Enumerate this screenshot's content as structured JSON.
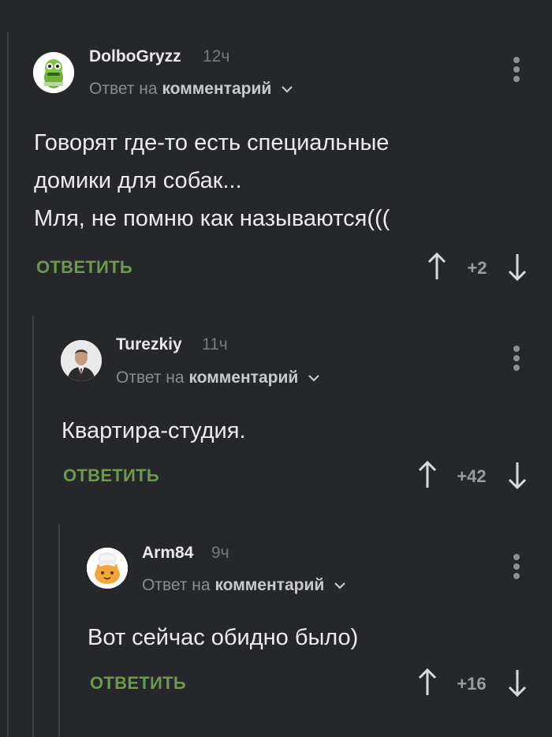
{
  "comments": [
    {
      "username": "DolboGryzz",
      "time": "12ч",
      "reply_prefix": "Ответ на",
      "reply_target": "комментарий",
      "text": "Говорят где-то есть специальные\nдомики для собак...\nМля, не помню как называются(((",
      "reply_label": "ОТВЕТИТЬ",
      "score": "+2",
      "avatar_icon": "green-character-avatar"
    },
    {
      "username": "Turezkiy",
      "time": "11ч",
      "reply_prefix": "Ответ на",
      "reply_target": "комментарий",
      "text": "Квартира-студия.",
      "reply_label": "ОТВЕТИТЬ",
      "score": "+42",
      "avatar_icon": "man-in-suit-avatar"
    },
    {
      "username": "Arm84",
      "time": "9ч",
      "reply_prefix": "Ответ на",
      "reply_target": "комментарий",
      "text": "Вот сейчас обидно было)",
      "reply_label": "ОТВЕТИТЬ",
      "score": "+16",
      "avatar_icon": "orange-cat-chef-avatar"
    }
  ],
  "colors": {
    "background": "#25272a",
    "reply_green": "#6b9a4a",
    "thread_line": "#3e4044"
  }
}
